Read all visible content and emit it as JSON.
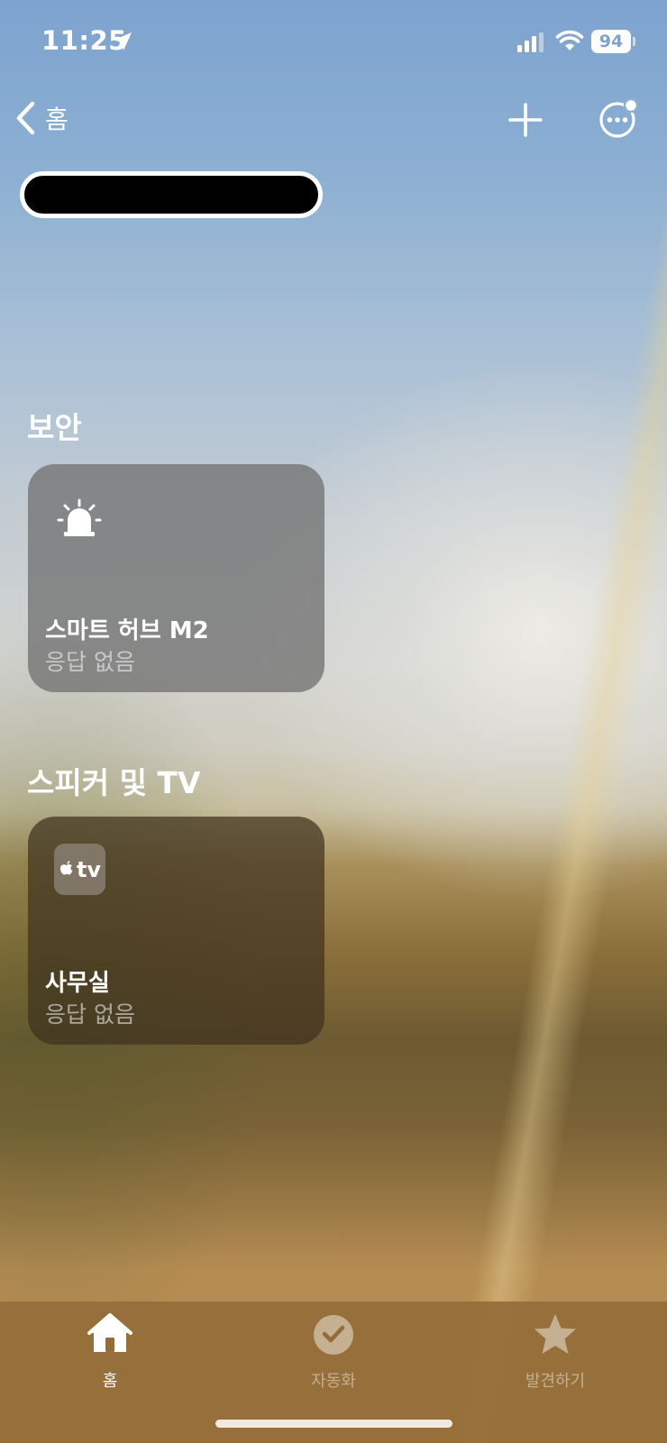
{
  "status_bar": {
    "time": "11:25",
    "battery_level": "94",
    "location_icon": "location-arrow-icon",
    "signal_icon": "cellular-signal-icon",
    "wifi_icon": "wifi-icon"
  },
  "nav": {
    "back_label": "홈",
    "add_icon": "plus-icon",
    "more_icon": "more-ellipsis-icon"
  },
  "sections": [
    {
      "title": "보안",
      "tiles": [
        {
          "name": "스마트 허브 M2",
          "status": "응답 없음",
          "icon": "siren-icon"
        }
      ]
    },
    {
      "title": "스피커 및 TV",
      "tiles": [
        {
          "name": "사무실",
          "status": "응답 없음",
          "icon": "apple-tv-icon",
          "icon_text": "tv"
        }
      ]
    }
  ],
  "tab_bar": {
    "tabs": [
      {
        "label": "홈",
        "icon": "house-icon",
        "active": true
      },
      {
        "label": "자동화",
        "icon": "clock-check-icon",
        "active": false
      },
      {
        "label": "발견하기",
        "icon": "star-icon",
        "active": false
      }
    ]
  },
  "colors": {
    "tile_security": "#767676",
    "tile_tv": "#3e321e",
    "tab_bar": "#946c38",
    "battery_text": "#7fa3cc"
  }
}
